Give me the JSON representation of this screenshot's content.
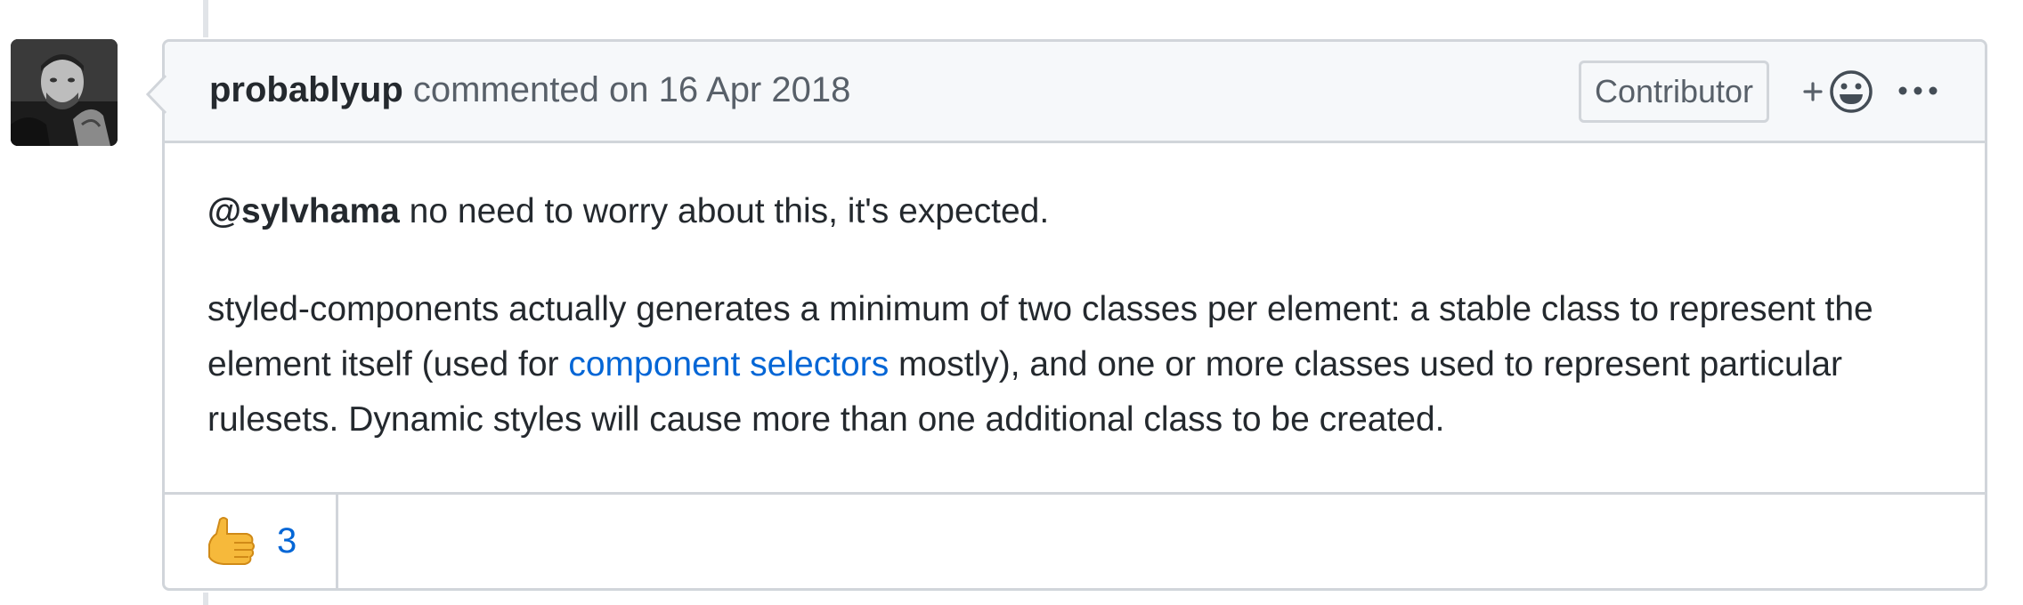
{
  "comment": {
    "author": "probablyup",
    "meta_text": "commented on 16 Apr 2018",
    "badge": "Contributor",
    "add_reaction_icon": "smiley-plus-icon",
    "more_icon": "kebab-horizontal-icon"
  },
  "body": {
    "mention": "@sylvhama",
    "line1_rest": " no need to worry about this, it's expected.",
    "para2_before_link": "styled-components actually generates a minimum of two classes per element: a stable class to represent the element itself (used for ",
    "link_text": "component selectors",
    "para2_after_link": " mostly), and one or more classes used to represent particular rulesets. Dynamic styles will cause more than one additional class to be created."
  },
  "reactions": [
    {
      "icon": "thumbs-up-icon",
      "count": "3"
    }
  ],
  "colors": {
    "link": "#0366d6",
    "border": "#d1d5da",
    "header_bg": "#f6f8fa",
    "muted_text": "#586069"
  }
}
